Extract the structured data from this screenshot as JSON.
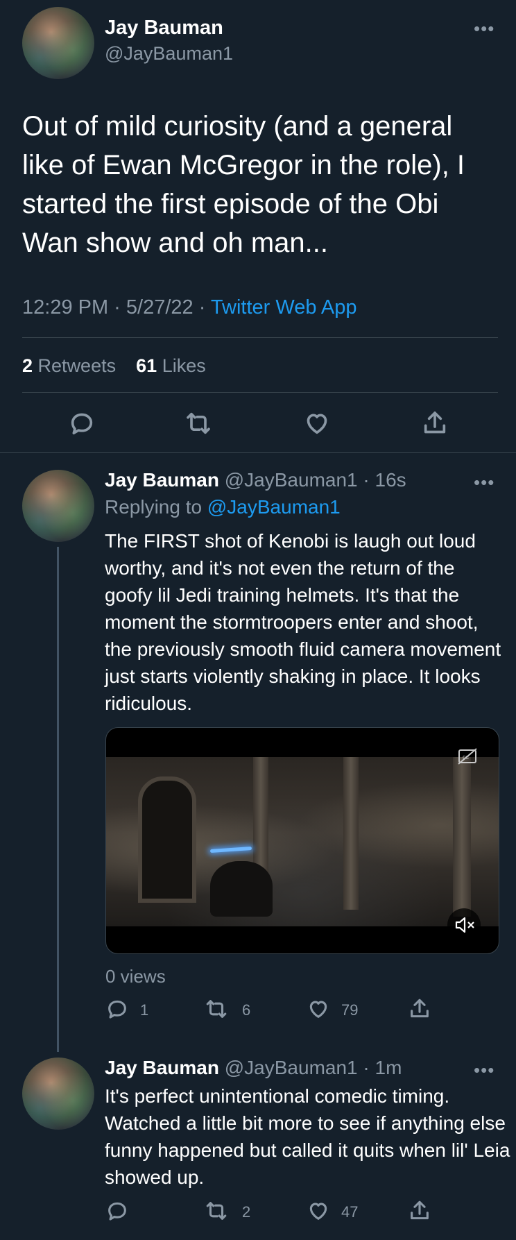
{
  "main_tweet": {
    "author_name": "Jay Bauman",
    "handle": "@JayBauman1",
    "text": "Out of mild curiosity (and a general like of Ewan McGregor in the role), I started the first episode of the Obi Wan show and oh man...",
    "time_date": "12:29 PM · 5/27/22 · ",
    "source": "Twitter Web App",
    "retweets_count": "2",
    "retweets_label": "Retweets",
    "likes_count": "61",
    "likes_label": "Likes"
  },
  "reply1": {
    "author_name": "Jay Bauman",
    "handle_time": "@JayBauman1 · 16s",
    "replying_label": "Replying to ",
    "replying_handle": "@JayBauman1",
    "text": "The FIRST shot of Kenobi is laugh out loud worthy, and it's not even the return of the goofy lil Jedi training helmets. It's that the moment the stormtroopers enter and shoot, the previously smooth fluid camera movement just starts violently shaking in place. It looks ridiculous.",
    "views": "0 views",
    "replies": "1",
    "retweets": "6",
    "likes": "79"
  },
  "reply2": {
    "author_name": "Jay Bauman",
    "handle_time": "@JayBauman1 · 1m",
    "text": "It's perfect unintentional comedic timing. Watched a little bit more to see if anything else funny happened but called it quits when lil' Leia showed up.",
    "replies": "",
    "retweets": "2",
    "likes": "47"
  },
  "icons": {
    "more": "more-horizontal-icon",
    "reply": "reply-icon",
    "retweet": "retweet-icon",
    "like": "heart-icon",
    "share": "share-icon",
    "captions": "captions-off-icon",
    "mute": "volume-muted-icon"
  },
  "colors": {
    "background": "#15202b",
    "link": "#1d9bf0",
    "muted": "#8b98a5"
  }
}
